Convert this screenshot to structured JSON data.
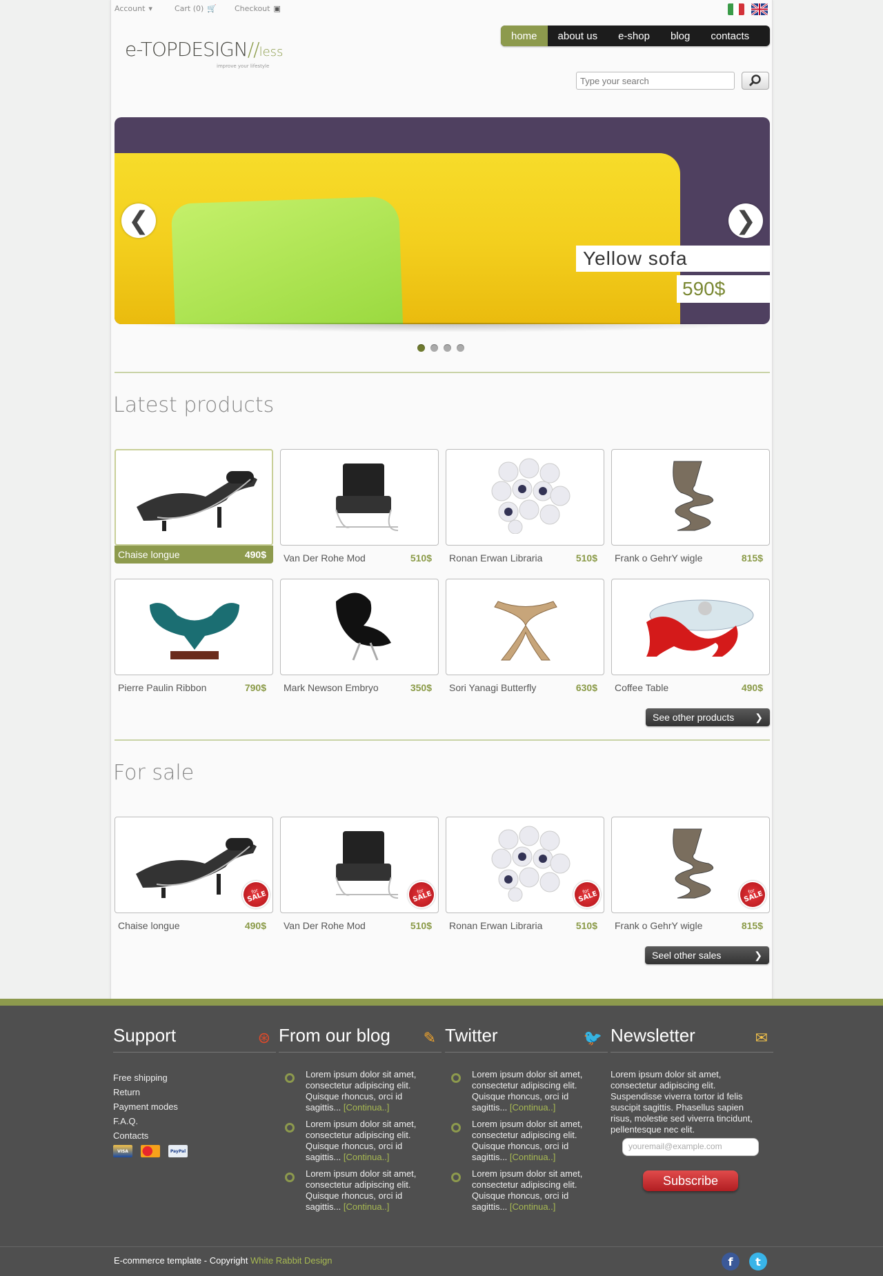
{
  "topbar": {
    "account": "Account",
    "cart": "Cart (0)",
    "checkout": "Checkout"
  },
  "logo": {
    "main": "e-TOPDESIGN",
    "suffix": "less",
    "tagline": "improve your lifestyle"
  },
  "nav": [
    "home",
    "about us",
    "e-shop",
    "blog",
    "contacts"
  ],
  "search": {
    "placeholder": "Type your search"
  },
  "slider": {
    "title": "Yellow sofa",
    "price": "590$",
    "prev": "❮",
    "next": "❯",
    "slides": 4,
    "active_slide": 1
  },
  "latest": {
    "title": "Latest products",
    "products": [
      {
        "name": "Chaise longue",
        "price": "490$"
      },
      {
        "name": "Van Der Rohe Mod",
        "price": "510$"
      },
      {
        "name": "Ronan Erwan Libraria",
        "price": "510$"
      },
      {
        "name": "Frank o GehrY wigle",
        "price": "815$"
      },
      {
        "name": "Pierre Paulin Ribbon",
        "price": "790$"
      },
      {
        "name": "Mark Newson Embryo",
        "price": "350$"
      },
      {
        "name": "Sori Yanagi Butterfly",
        "price": "630$"
      },
      {
        "name": "Coffee Table",
        "price": "490$"
      }
    ],
    "more": "See other products"
  },
  "sale": {
    "title": "For sale",
    "badge_small": "for",
    "badge": "SALE",
    "products": [
      {
        "name": "Chaise longue",
        "price": "490$"
      },
      {
        "name": "Van Der Rohe Mod",
        "price": "510$"
      },
      {
        "name": "Ronan Erwan Libraria",
        "price": "510$"
      },
      {
        "name": "Frank o GehrY wigle",
        "price": "815$"
      }
    ],
    "more": "Seel other sales"
  },
  "footer": {
    "support": {
      "title": "Support",
      "links": [
        "Free shipping",
        "Return",
        "Payment modes",
        "F.A.Q.",
        "Contacts"
      ],
      "payment": [
        "VISA",
        "MC",
        "PayPal"
      ]
    },
    "blog": {
      "title": "From our blog",
      "text": "Lorem ipsum dolor sit amet, consectetur adipiscing elit. Quisque rhoncus, orci id sagittis...",
      "more": "[Continua..]"
    },
    "twitter": {
      "title": "Twitter",
      "text": "Lorem ipsum dolor sit amet, consectetur adipiscing elit. Quisque rhoncus, orci id sagittis...",
      "more": "[Continua..]"
    },
    "newsletter": {
      "title": "Newsletter",
      "text": "Lorem ipsum dolor sit amet, consectetur adipiscing elit. Suspendisse viverra tortor id felis suscipit sagittis. Phasellus sapien risus, molestie sed viverra tincidunt, pellentesque nec elit.",
      "placeholder": "youremail@example.com",
      "button": "Subscribe"
    },
    "copyright": "E-commerce template - Copyright ",
    "author": "White Rabbit Design"
  },
  "colors": {
    "accent": "#8d9a4d",
    "dark": "#1c1c1c",
    "footer": "#4f4f4f",
    "sale": "#c9202a"
  }
}
